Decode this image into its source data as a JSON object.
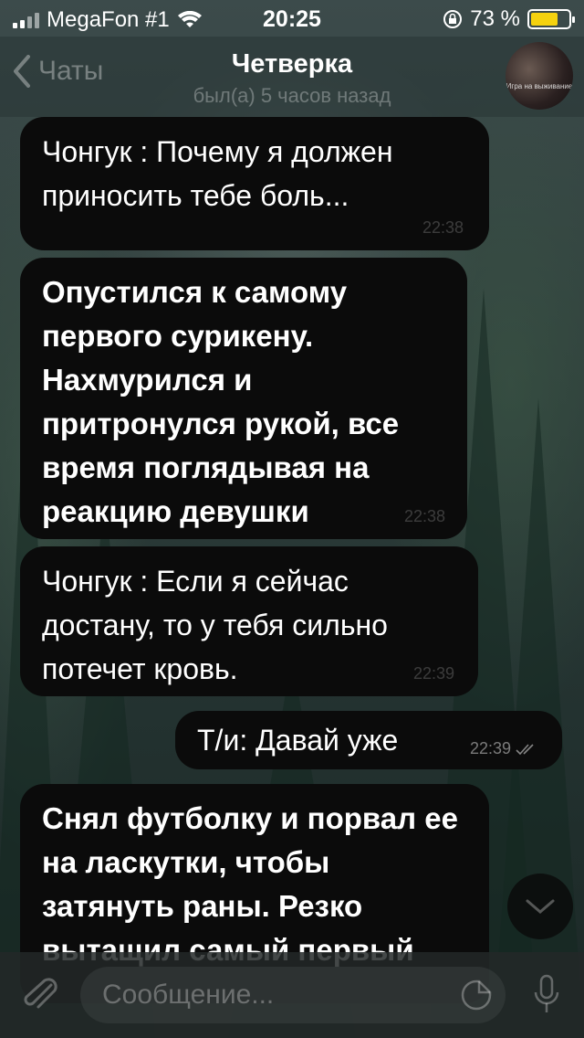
{
  "status_bar": {
    "carrier": "MegaFon #1",
    "time": "20:25",
    "battery_percent": "73 %",
    "battery_level": 0.73
  },
  "header": {
    "back_label": "Чаты",
    "title": "Четверка",
    "subtitle": "был(а) 5 часов назад",
    "avatar_caption": "Игра на выживание"
  },
  "messages": [
    {
      "text": "Чонгук : Почему я должен приносить тебе боль...",
      "time": "22:38",
      "bold": false,
      "outgoing": false
    },
    {
      "text": "Опустился к самому первого сурикену. Нахмурился и притронулся рукой, все время поглядывая на реакцию девушки",
      "time": "22:38",
      "bold": true,
      "outgoing": false
    },
    {
      "text": "Чонгук : Если я сейчас достану, то у тебя сильно потечет кровь.",
      "time": "22:39",
      "bold": false,
      "outgoing": false
    },
    {
      "text": "Т/и: Давай уже",
      "time": "22:39",
      "bold": false,
      "outgoing": true
    },
    {
      "text": "Снял футболку и порвал ее на ласкутки, чтобы затянуть раны. Резко вытащил самый первый",
      "time": "",
      "bold": true,
      "outgoing": false
    }
  ],
  "composer": {
    "placeholder": "Сообщение..."
  },
  "icons": [
    "back-chevron-icon",
    "wifi-icon",
    "lock-rotation-icon",
    "attach-icon",
    "sticker-icon",
    "microphone-icon",
    "chevron-down-icon",
    "double-check-icon"
  ]
}
